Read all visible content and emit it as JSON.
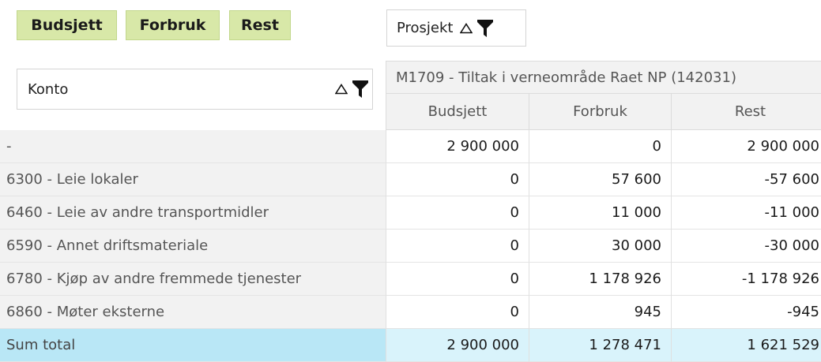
{
  "measures": [
    "Budsjett",
    "Forbruk",
    "Rest"
  ],
  "project_field": {
    "label": "Prosjekt"
  },
  "account_field": {
    "label": "Konto"
  },
  "icons": {
    "sort": "sort-triangle-icon",
    "filter": "filter-funnel-icon"
  },
  "project_header": "M1709 - Tiltak i verneområde Raet NP (142031)",
  "columns": [
    "Budsjett",
    "Forbruk",
    "Rest"
  ],
  "rows": [
    {
      "label": "-",
      "budsjett": "2 900 000",
      "forbruk": "0",
      "rest": "2 900 000"
    },
    {
      "label": "6300 - Leie lokaler",
      "budsjett": "0",
      "forbruk": "57 600",
      "rest": "-57 600"
    },
    {
      "label": "6460 - Leie av andre transportmidler",
      "budsjett": "0",
      "forbruk": "11 000",
      "rest": "-11 000"
    },
    {
      "label": "6590 - Annet driftsmateriale",
      "budsjett": "0",
      "forbruk": "30 000",
      "rest": "-30 000"
    },
    {
      "label": "6780 - Kjøp av andre fremmede tjenester",
      "budsjett": "0",
      "forbruk": "1 178 926",
      "rest": "-1 178 926"
    },
    {
      "label": "6860 - Møter eksterne",
      "budsjett": "0",
      "forbruk": "945",
      "rest": "-945"
    }
  ],
  "total": {
    "label": "Sum total",
    "budsjett": "2 900 000",
    "forbruk": "1 278 471",
    "rest": "1 621 529"
  },
  "colors": {
    "chip": "#d8e8a8",
    "header_bg": "#f2f2f2",
    "total_label_bg": "#b9e7f6",
    "total_value_bg": "#d9f3fb"
  }
}
